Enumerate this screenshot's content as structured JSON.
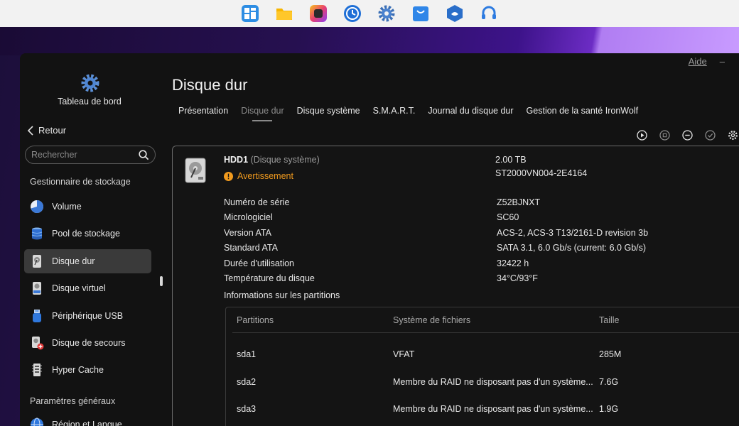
{
  "dock": {
    "icons": [
      "app-grid-icon",
      "folder-icon",
      "photo-app-icon",
      "clock-backup-icon",
      "gear-icon",
      "app-store-icon",
      "container-icon",
      "headset-support-icon"
    ]
  },
  "window": {
    "help_label": "Aide",
    "minimize_label": "–"
  },
  "sidebar": {
    "dashboard_label": "Tableau de bord",
    "back_label": "Retour",
    "search_placeholder": "Rechercher",
    "section_storage": "Gestionnaire de stockage",
    "section_general": "Paramètres généraux",
    "items": [
      {
        "label": "Volume",
        "icon": "pie-volume-icon"
      },
      {
        "label": "Pool de stockage",
        "icon": "storage-pool-icon"
      },
      {
        "label": "Disque dur",
        "icon": "hard-disk-icon",
        "active": true
      },
      {
        "label": "Disque virtuel",
        "icon": "virtual-disk-icon"
      },
      {
        "label": "Périphérique USB",
        "icon": "usb-device-icon"
      },
      {
        "label": "Disque de secours",
        "icon": "spare-disk-icon"
      },
      {
        "label": "Hyper Cache",
        "icon": "hyper-cache-icon"
      },
      {
        "label": "Région et Langue",
        "icon": "globe-icon"
      }
    ]
  },
  "main": {
    "title": "Disque dur",
    "tabs": [
      {
        "label": "Présentation"
      },
      {
        "label": "Disque dur",
        "active": true
      },
      {
        "label": "Disque système"
      },
      {
        "label": "S.M.A.R.T."
      },
      {
        "label": "Journal du disque dur"
      },
      {
        "label": "Gestion de la santé IronWolf"
      }
    ],
    "toolbar": [
      "play-icon",
      "stop-icon",
      "minus-circle-icon",
      "check-circle-icon",
      "gear-icon"
    ]
  },
  "disk": {
    "name": "HDD1",
    "subtitle": "(Disque système)",
    "status": "Avertissement",
    "capacity": "2.00 TB",
    "model": "ST2000VN004-2E4164",
    "details": [
      {
        "label": "Numéro de série",
        "value": "Z52BJNXT"
      },
      {
        "label": "Micrologiciel",
        "value": "SC60"
      },
      {
        "label": "Version ATA",
        "value": "ACS-2, ACS-3 T13/2161-D revision 3b"
      },
      {
        "label": "Standard ATA",
        "value": "SATA 3.1, 6.0 Gb/s (current: 6.0 Gb/s)"
      },
      {
        "label": "Durée d'utilisation",
        "value": "32422 h"
      },
      {
        "label": "Température du disque",
        "value": "34°C/93°F"
      }
    ],
    "partitions_title": "Informations sur les partitions",
    "partitions_headers": [
      "Partitions",
      "Système de fichiers",
      "Taille"
    ],
    "partitions": [
      {
        "name": "sda1",
        "fs": "VFAT",
        "size": "285M"
      },
      {
        "name": "sda2",
        "fs": "Membre du RAID ne disposant pas d'un système...",
        "size": "7.6G"
      },
      {
        "name": "sda3",
        "fs": "Membre du RAID ne disposant pas d'un système...",
        "size": "1.9G"
      }
    ]
  },
  "colors": {
    "warning": "#f09a1e",
    "active_item": "#3a3a3a",
    "background": "#121212"
  }
}
